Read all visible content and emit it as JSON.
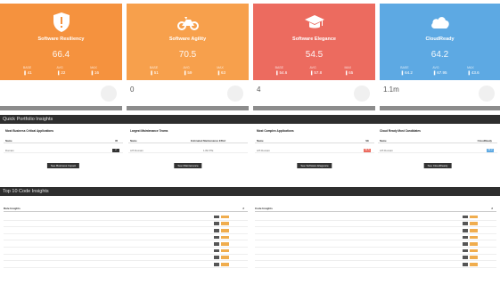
{
  "colors": {
    "resiliency": "#f5923e",
    "agility": "#f7a04c",
    "elegance": "#ec6b5f",
    "cloudready": "#5da9e3",
    "section_bg": "#2e2e2e"
  },
  "cards": [
    {
      "key": "resiliency",
      "icon": "shield-icon",
      "title": "Software Resiliency",
      "score": "66.4",
      "metrics": [
        {
          "label": "BASE",
          "value": "41"
        },
        {
          "label": "AVG",
          "value": "22"
        },
        {
          "label": "MAX",
          "value": "16"
        }
      ]
    },
    {
      "key": "agility",
      "icon": "motorcycle-icon",
      "title": "Software Agility",
      "score": "70.5",
      "metrics": [
        {
          "label": "BASE",
          "value": "51"
        },
        {
          "label": "AVG",
          "value": "59"
        },
        {
          "label": "MAX",
          "value": "63"
        }
      ]
    },
    {
      "key": "elegance",
      "icon": "graduation-cap-icon",
      "title": "Software Elegance",
      "score": "54.5",
      "metrics": [
        {
          "label": "BASE",
          "value": "54.6"
        },
        {
          "label": "AVG",
          "value": "57.8"
        },
        {
          "label": "MAX",
          "value": "65"
        }
      ]
    },
    {
      "key": "cloudready",
      "icon": "cloud-icon",
      "title": "CloudReady",
      "score": "64.2",
      "metrics": [
        {
          "label": "BASE",
          "value": "64.2"
        },
        {
          "label": "AVG",
          "value": "67.95"
        },
        {
          "label": "MAX",
          "value": "43.6"
        }
      ]
    }
  ],
  "stats": [
    {
      "value": "",
      "caption": ""
    },
    {
      "value": "0",
      "caption": ""
    },
    {
      "value": "4",
      "caption": ""
    },
    {
      "value": "1.1m",
      "caption": ""
    }
  ],
  "sections": {
    "quick": "Quick Portfolio Insights",
    "code": "Top 10 Code Insights"
  },
  "quick": [
    {
      "title": "Most Business Critical Applications",
      "head": [
        "Name",
        "",
        "IR"
      ],
      "row": [
        "Domain",
        "",
        "2"
      ],
      "tag_color": "#333333",
      "button": "See Business Impact"
    },
    {
      "title": "Largest Maintenance Teams",
      "head": [
        "Name",
        "Estimated Maintenance Effort",
        ""
      ],
      "row": [
        "AIT-Domain",
        "",
        "1.8k FTE"
      ],
      "tag_color": "",
      "button": "See Maintenance"
    },
    {
      "title": "Most Complex Applications",
      "head": [
        "Name",
        "",
        "SE"
      ],
      "row": [
        "AIT-Domain",
        "",
        "54.5"
      ],
      "tag_color": "#ec6b5f",
      "button": "See Software Elegance"
    },
    {
      "title": "Cloud Ready Most Candidates",
      "head": [
        "Name",
        "",
        "CloudReady"
      ],
      "row": [
        "AIT-Domain",
        "",
        "64.2"
      ],
      "tag_color": "#5da9e3",
      "button": "See CloudReady"
    }
  ],
  "code_insights": {
    "left_header": "Rule Insights",
    "right_header": "Code Insights",
    "hash": "#",
    "left_rows": [
      "",
      "",
      "",
      "",
      "",
      "",
      "",
      ""
    ],
    "right_rows": [
      "",
      "",
      "",
      "",
      "",
      "",
      "",
      ""
    ]
  }
}
